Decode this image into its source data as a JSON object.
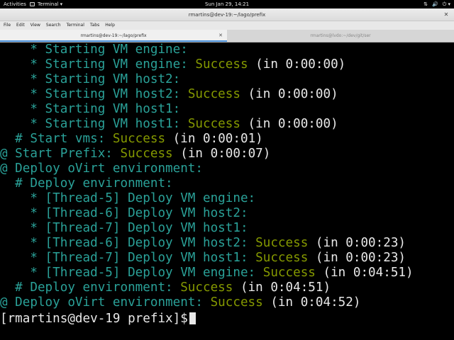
{
  "topbar": {
    "activities": "Activities",
    "app_name": "Terminal",
    "app_menu_arrow": "▾",
    "clock": "Sun Jan 29, 14:21",
    "tray": [
      "⇅",
      "🔊",
      "⏻ ▾"
    ]
  },
  "window": {
    "title": "rmartins@dev-19:~/lago/prefix",
    "close_icon": "✕"
  },
  "menubar": {
    "items": [
      "File",
      "Edit",
      "View",
      "Search",
      "Terminal",
      "Tabs",
      "Help"
    ]
  },
  "tabs": [
    {
      "label": "rmartins@dev-19:~/lago/prefix",
      "active": true,
      "close": "✕"
    },
    {
      "label": "rmartins@lvdo:~/dev/git/ser",
      "active": false
    }
  ],
  "terminal": {
    "lines": [
      {
        "pre": "    * Starting VM engine:",
        "succ": "",
        "dur": ""
      },
      {
        "pre": "    * Starting VM engine: ",
        "succ": "Success",
        "dur": " (in 0:00:00)"
      },
      {
        "pre": "    * Starting VM host2:",
        "succ": "",
        "dur": ""
      },
      {
        "pre": "    * Starting VM host2: ",
        "succ": "Success",
        "dur": " (in 0:00:00)"
      },
      {
        "pre": "    * Starting VM host1:",
        "succ": "",
        "dur": ""
      },
      {
        "pre": "    * Starting VM host1: ",
        "succ": "Success",
        "dur": " (in 0:00:00)"
      },
      {
        "pre": "  # Start vms: ",
        "succ": "Success",
        "dur": " (in 0:00:01)"
      },
      {
        "pre": "@ Start Prefix: ",
        "succ": "Success",
        "dur": " (in 0:00:07)"
      },
      {
        "pre": "@ Deploy oVirt environment:",
        "succ": "",
        "dur": ""
      },
      {
        "pre": "  # Deploy environment:",
        "succ": "",
        "dur": ""
      },
      {
        "pre": "    * [Thread-5] Deploy VM engine:",
        "succ": "",
        "dur": ""
      },
      {
        "pre": "    * [Thread-6] Deploy VM host2:",
        "succ": "",
        "dur": ""
      },
      {
        "pre": "    * [Thread-7] Deploy VM host1:",
        "succ": "",
        "dur": ""
      },
      {
        "pre": "    * [Thread-6] Deploy VM host2: ",
        "succ": "Success",
        "dur": " (in 0:00:23)"
      },
      {
        "pre": "    * [Thread-7] Deploy VM host1: ",
        "succ": "Success",
        "dur": " (in 0:00:23)"
      },
      {
        "pre": "    * [Thread-5] Deploy VM engine: ",
        "succ": "Success",
        "dur": " (in 0:04:51)"
      },
      {
        "pre": "  # Deploy environment: ",
        "succ": "Success",
        "dur": " (in 0:04:51)"
      },
      {
        "pre": "@ Deploy oVirt environment: ",
        "succ": "Success",
        "dur": " (in 0:04:52)"
      }
    ],
    "prompt": "[rmartins@dev-19 prefix]$"
  },
  "colors": {
    "text_teal": "#2aa198",
    "success_green": "#859900",
    "plain_white": "#e8e8e8",
    "background": "#000000"
  }
}
